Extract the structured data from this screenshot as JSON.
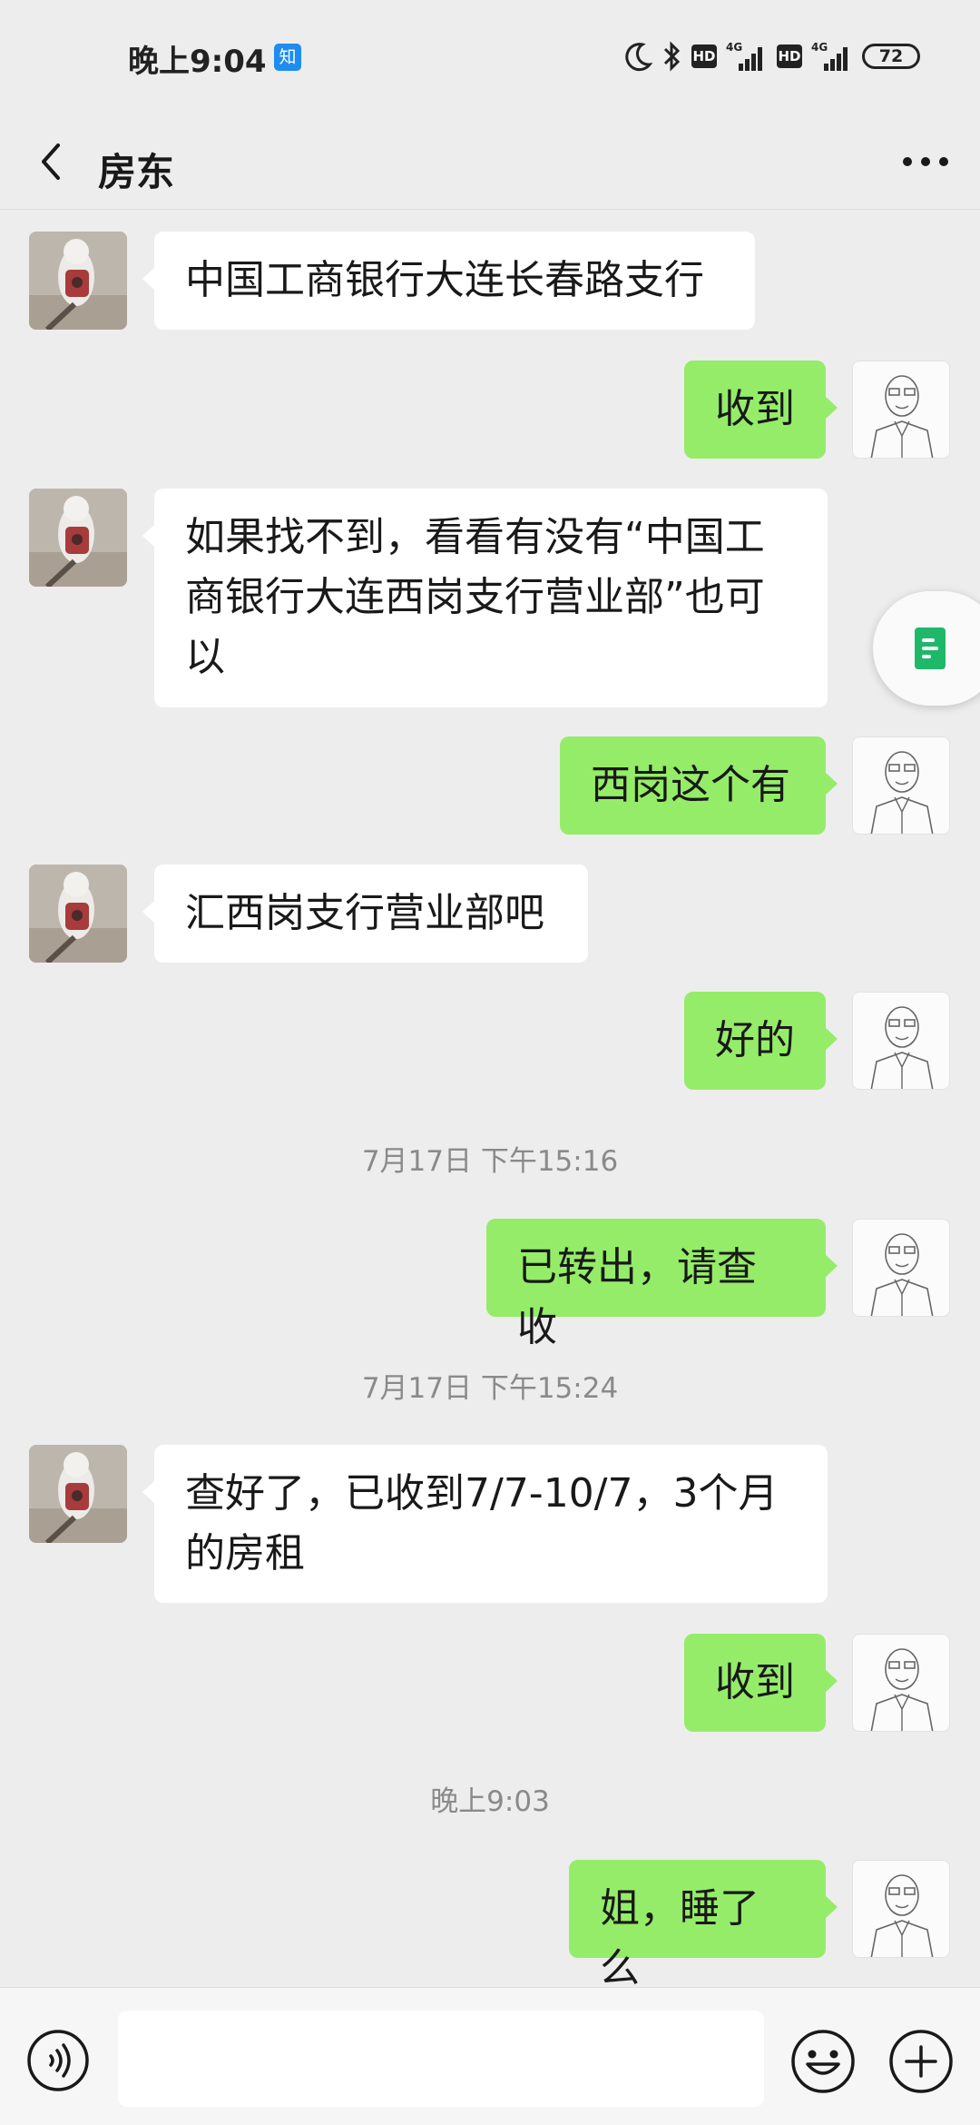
{
  "status_bar": {
    "time": "晚上9:04",
    "app_badge": "知",
    "hd1": "HD",
    "hd2": "HD",
    "net1": "4G",
    "net2": "4G",
    "battery": "72"
  },
  "header": {
    "title": "房东"
  },
  "messages": [
    {
      "side": "left",
      "text": "中国工商银行大连长春路支行"
    },
    {
      "side": "right",
      "text": "收到"
    },
    {
      "side": "left",
      "text": "如果找不到，看看有没有“中国工商银行大连西岗支行营业部”也可以"
    },
    {
      "side": "right",
      "text": "西岗这个有"
    },
    {
      "side": "left",
      "text": "汇西岗支行营业部吧"
    },
    {
      "side": "right",
      "text": "好的"
    },
    {
      "side": "right",
      "text": "已转出，请查收"
    },
    {
      "side": "left",
      "text": "查好了，已收到7/7-10/7，3个月的房租"
    },
    {
      "side": "right",
      "text": "收到"
    },
    {
      "side": "right",
      "text": "姐，睡了么"
    }
  ],
  "timestamps": [
    "7月17日 下午15:16",
    "7月17日 下午15:24",
    "晚上9:03"
  ],
  "colors": {
    "background": "#ededed",
    "bubble_self": "#95ec69",
    "bubble_other": "#ffffff",
    "float_icon": "#1fb869"
  },
  "icons": [
    "back-arrow",
    "more-dots",
    "moon",
    "bluetooth",
    "signal",
    "battery",
    "voice",
    "emoji",
    "plus",
    "document"
  ],
  "input": {
    "value": ""
  }
}
